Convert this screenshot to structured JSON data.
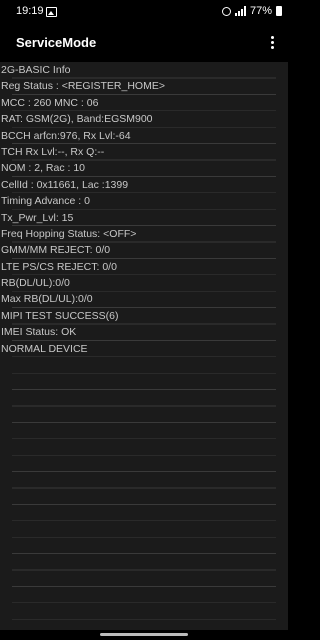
{
  "status_bar": {
    "time": "19:19",
    "battery_percent": "77%"
  },
  "app_bar": {
    "title": "ServiceMode"
  },
  "info_lines": [
    "2G-BASIC Info",
    "Reg Status : <REGISTER_HOME>",
    "MCC : 260 MNC : 06",
    "RAT: GSM(2G), Band:EGSM900",
    "BCCH arfcn:976, Rx Lvl:-64",
    "TCH Rx Lvl:--, Rx Q:--",
    "NOM : 2, Rac : 10",
    "CellId : 0x11661, Lac :1399",
    "Timing Advance : 0",
    "Tx_Pwr_Lvl: 15",
    "Freq Hopping Status: <OFF>",
    "GMM/MM REJECT: 0/0",
    "LTE PS/CS REJECT: 0/0",
    "RB(DL/UL):0/0",
    "Max RB(DL/UL):0/0",
    "MIPI TEST SUCCESS(6)",
    "IMEI Status: OK",
    "NORMAL DEVICE"
  ],
  "icons": {
    "gallery": "gallery-icon",
    "alarm": "alarm-icon",
    "signal": "signal-icon",
    "battery": "battery-icon",
    "overflow": "overflow-menu-icon"
  }
}
